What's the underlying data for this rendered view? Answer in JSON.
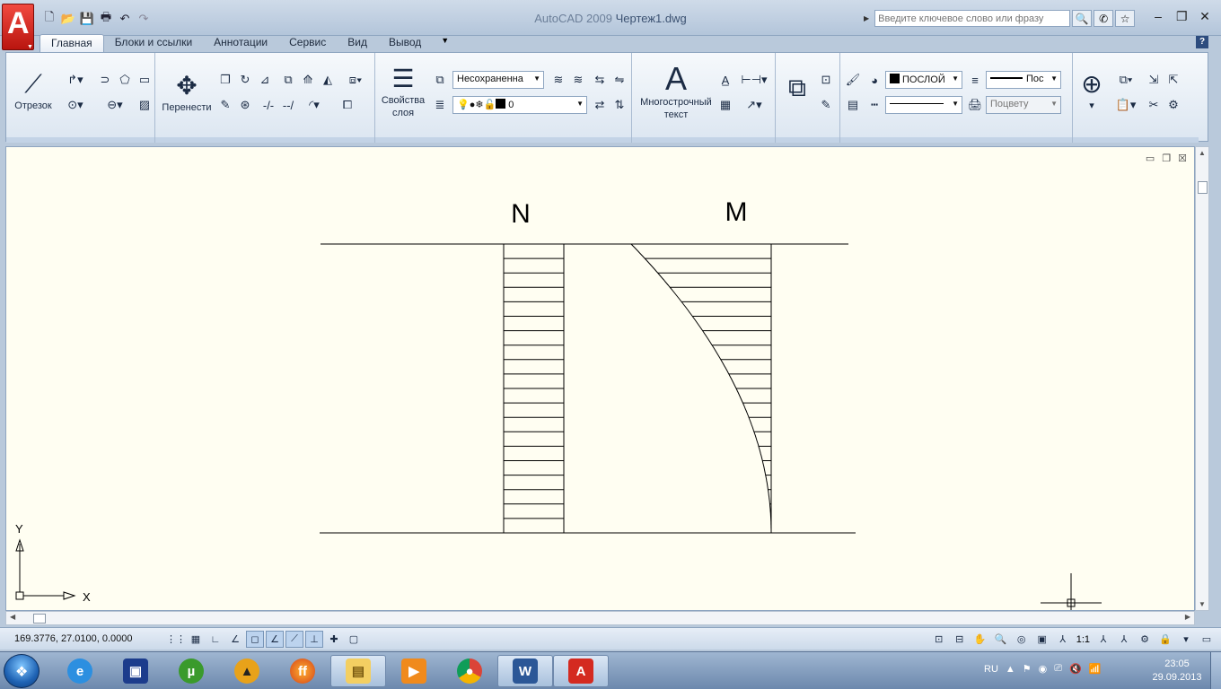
{
  "window": {
    "app_name": "AutoCAD 2009",
    "doc_name": "Чертеж1.dwg"
  },
  "search": {
    "placeholder": "Введите ключевое слово или фразу"
  },
  "ribbon_tabs": [
    "Главная",
    "Блоки и ссылки",
    "Аннотации",
    "Сервис",
    "Вид",
    "Вывод"
  ],
  "ribbon": {
    "draw": {
      "line_label": "Отрезок"
    },
    "modify": {
      "move_label": "Перенести"
    },
    "layers": {
      "props_label": "Свойства слоя",
      "state_value": "Несохраненна",
      "layer_value": "0"
    },
    "annotation": {
      "mtext_label": "Многострочный текст"
    },
    "properties": {
      "color_value": "ПОСЛОЙ",
      "lineweight_value": "Пос",
      "plotstyle_value": "Поцвету"
    }
  },
  "drawing": {
    "label_n": "N",
    "label_m": "M",
    "ucs_x": "X",
    "ucs_y": "Y",
    "n_hatch_lines": 20,
    "m_hatch_lines": 20
  },
  "status": {
    "coords": "169.3776, 27.0100, 0.0000",
    "scale": "1:1"
  },
  "taskbar": {
    "apps": [
      "ie-icon",
      "save-disk-icon",
      "utorrent-icon",
      "aimp-icon",
      "firefox-icon",
      "explorer-folder-icon",
      "media-player-icon",
      "chrome-icon",
      "word-icon",
      "autocad-icon"
    ],
    "language": "RU",
    "time": "23:05",
    "date": "29.09.2013"
  },
  "colors": {
    "canvas": "#fffef2",
    "autocad_red": "#d42a20",
    "ribbon_blue": "#dce6f1"
  }
}
